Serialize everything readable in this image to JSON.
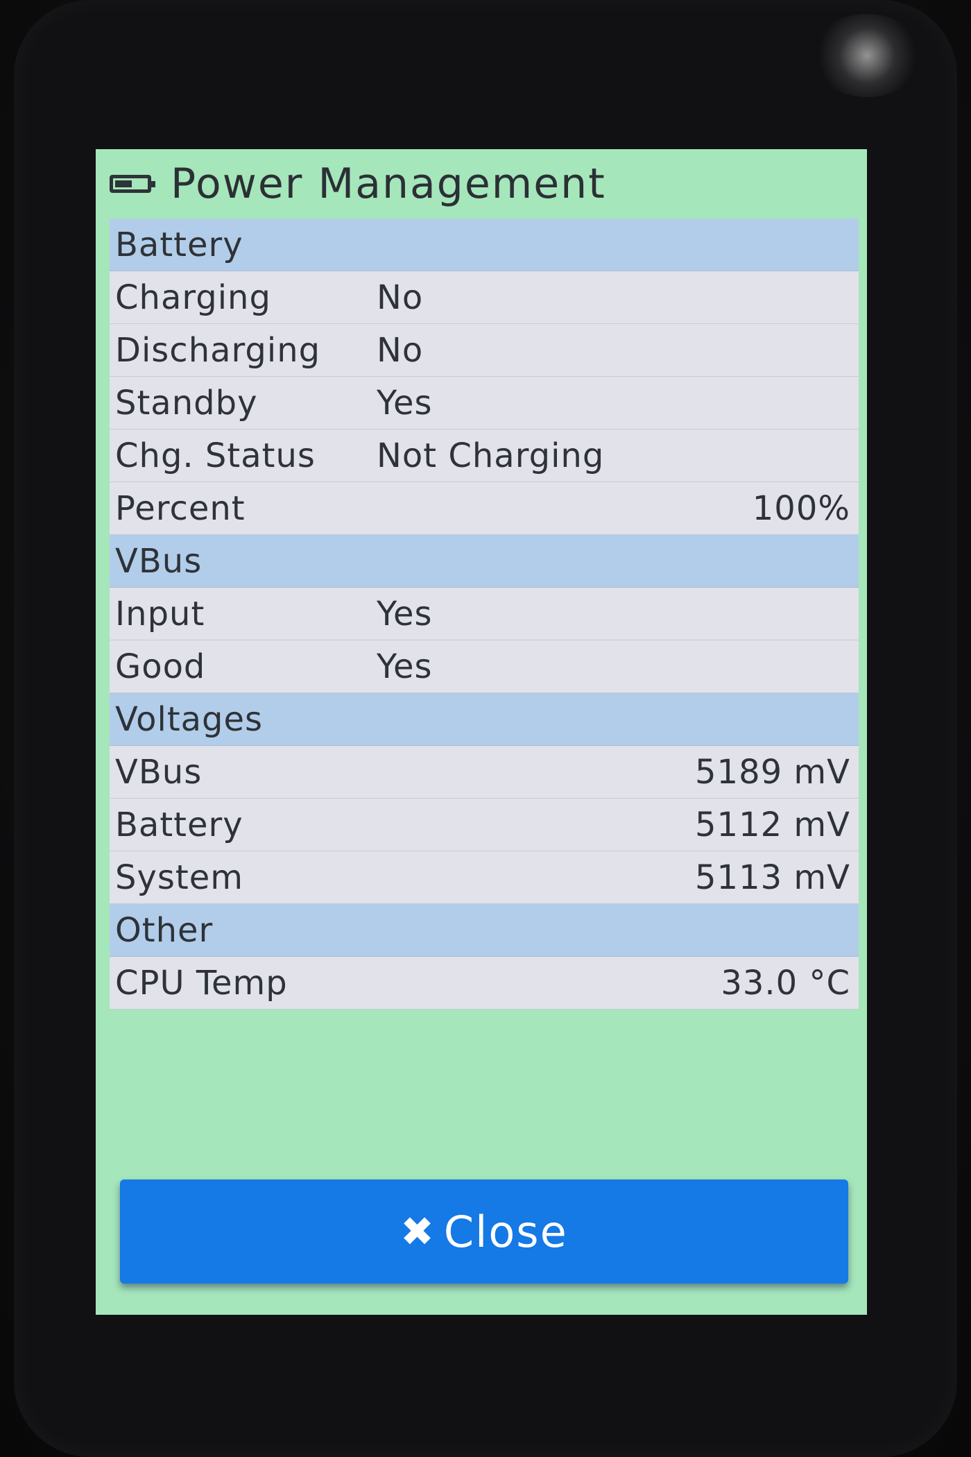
{
  "title_bar": {
    "icon": "battery-icon",
    "title": "Power Management"
  },
  "sections": {
    "battery": {
      "header": "Battery",
      "rows": [
        {
          "label": "Charging",
          "value": "No"
        },
        {
          "label": "Discharging",
          "value": "No"
        },
        {
          "label": "Standby",
          "value": "Yes"
        },
        {
          "label": "Chg. Status",
          "value": "Not Charging"
        },
        {
          "label": "Percent",
          "value": "100%"
        }
      ]
    },
    "vbus": {
      "header": "VBus",
      "rows": [
        {
          "label": "Input",
          "value": "Yes"
        },
        {
          "label": "Good",
          "value": "Yes"
        }
      ]
    },
    "voltages": {
      "header": "Voltages",
      "rows": [
        {
          "label": "VBus",
          "value": "5189 mV"
        },
        {
          "label": "Battery",
          "value": "5112 mV"
        },
        {
          "label": "System",
          "value": "5113 mV"
        }
      ]
    },
    "other": {
      "header": "Other",
      "rows": [
        {
          "label": "CPU Temp",
          "value": "33.0 °C"
        }
      ]
    }
  },
  "close_button": {
    "icon": "close-icon",
    "icon_glyph": "✖",
    "label": "Close"
  },
  "colors": {
    "screen_background": "#a6e6bb",
    "section_header": "#b2cdea",
    "row_background": "#e2e2ea",
    "button": "#1579e6",
    "text": "#2e3338"
  }
}
